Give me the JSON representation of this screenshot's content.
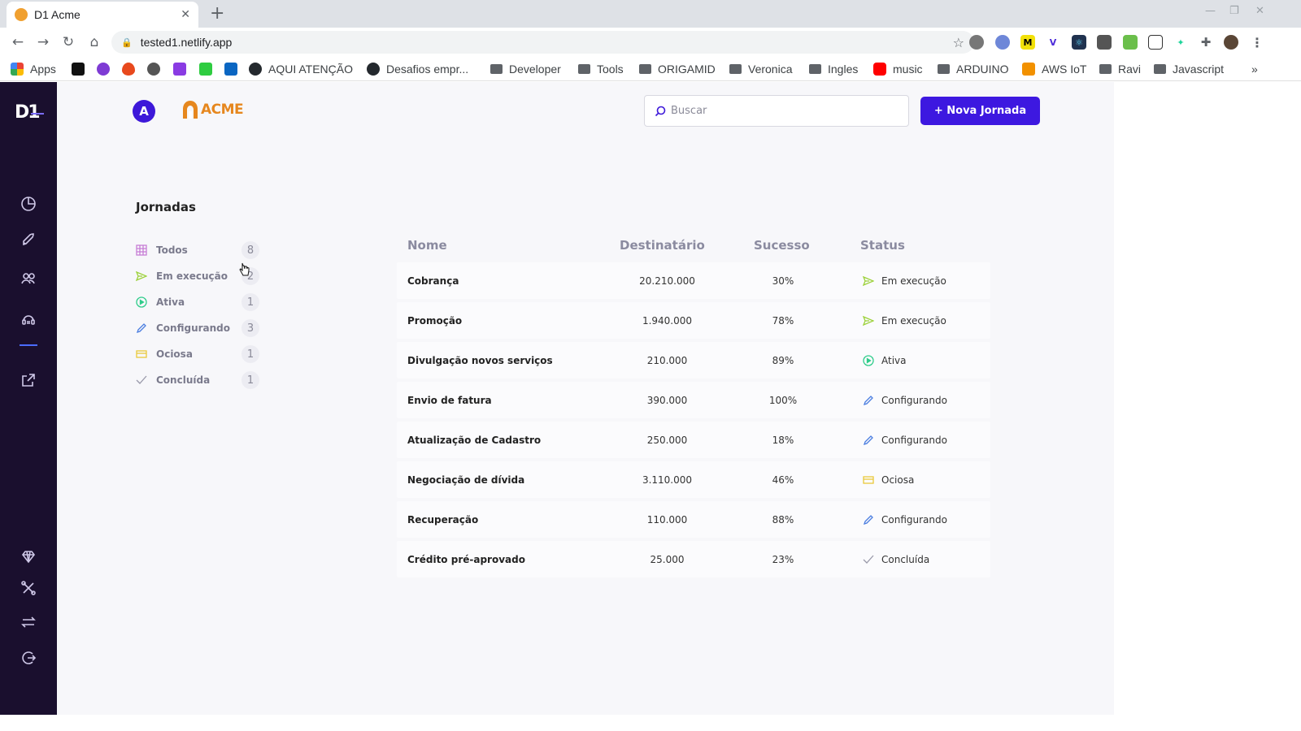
{
  "browser": {
    "tab_title": "D1 Acme",
    "url": "tested1.netlify.app",
    "bookmarks": [
      {
        "label": "Apps",
        "icon": "apps-icon"
      },
      {
        "label": "AQUI ATENÇÃO",
        "icon": "github-icon"
      },
      {
        "label": "Desafios empr...",
        "icon": "github-icon"
      },
      {
        "label": "Developer",
        "icon": "folder-icon"
      },
      {
        "label": "Tools",
        "icon": "folder-icon"
      },
      {
        "label": "ORIGAMID",
        "icon": "folder-icon"
      },
      {
        "label": "Veronica",
        "icon": "folder-icon"
      },
      {
        "label": "Ingles",
        "icon": "folder-icon"
      },
      {
        "label": "music",
        "icon": "youtube-icon"
      },
      {
        "label": "ARDUINO",
        "icon": "folder-icon"
      },
      {
        "label": "AWS IoT",
        "icon": "aws-icon"
      },
      {
        "label": "Ravi",
        "icon": "folder-icon"
      },
      {
        "label": "Javascript",
        "icon": "folder-icon"
      }
    ],
    "overflow_label": "»"
  },
  "app": {
    "logo": "D1",
    "avatar_letter": "A",
    "brand_name": "ACME",
    "search_placeholder": "Buscar",
    "new_button_label": "+ Nova Jornada",
    "section_title": "Jornadas",
    "accent_color": "#3d18e0",
    "sidebar_color": "#1a0f2e"
  },
  "filters": [
    {
      "label": "Todos",
      "count": "8",
      "icon": "grid-icon"
    },
    {
      "label": "Em execução",
      "count": "2",
      "icon": "send-icon"
    },
    {
      "label": "Ativa",
      "count": "1",
      "icon": "play-circle-icon"
    },
    {
      "label": "Configurando",
      "count": "3",
      "icon": "pencil-icon"
    },
    {
      "label": "Ociosa",
      "count": "1",
      "icon": "idle-icon"
    },
    {
      "label": "Concluída",
      "count": "1",
      "icon": "check-icon"
    }
  ],
  "table": {
    "headers": {
      "name": "Nome",
      "dest": "Destinatário",
      "success": "Sucesso",
      "status": "Status"
    },
    "rows": [
      {
        "name": "Cobrança",
        "dest": "20.210.000",
        "success": "30%",
        "status": "Em execução",
        "status_icon": "send-icon"
      },
      {
        "name": "Promoção",
        "dest": "1.940.000",
        "success": "78%",
        "status": "Em execução",
        "status_icon": "send-icon"
      },
      {
        "name": "Divulgação novos serviços",
        "dest": "210.000",
        "success": "89%",
        "status": "Ativa",
        "status_icon": "play-circle-icon"
      },
      {
        "name": "Envio de fatura",
        "dest": "390.000",
        "success": "100%",
        "status": "Configurando",
        "status_icon": "pencil-icon"
      },
      {
        "name": "Atualização de Cadastro",
        "dest": "250.000",
        "success": "18%",
        "status": "Configurando",
        "status_icon": "pencil-icon"
      },
      {
        "name": "Negociação de dívida",
        "dest": "3.110.000",
        "success": "46%",
        "status": "Ociosa",
        "status_icon": "idle-icon"
      },
      {
        "name": "Recuperação",
        "dest": "110.000",
        "success": "88%",
        "status": "Configurando",
        "status_icon": "pencil-icon"
      },
      {
        "name": "Crédito pré-aprovado",
        "dest": "25.000",
        "success": "23%",
        "status": "Concluída",
        "status_icon": "check-icon"
      }
    ]
  }
}
